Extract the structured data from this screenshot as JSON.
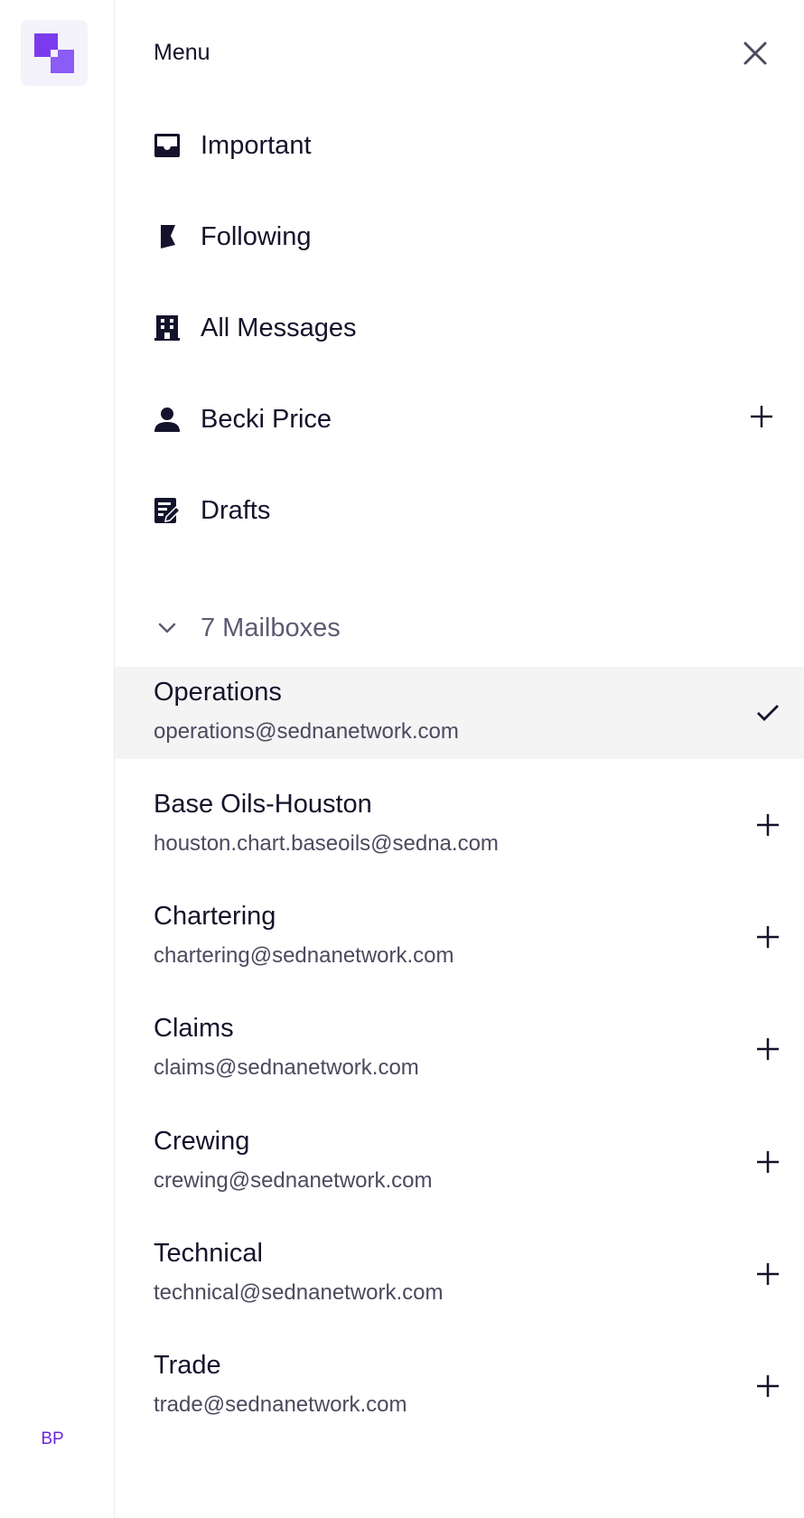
{
  "header": {
    "title": "Menu",
    "close_icon": "close-icon"
  },
  "rail": {
    "logo_icon": "app-logo-icon",
    "avatar_initials": "BP",
    "avatar_color": "#6d28d9",
    "logo_color": "#8b5cf6"
  },
  "nav": [
    {
      "label": "Important",
      "icon": "inbox-icon",
      "has_add": false
    },
    {
      "label": "Following",
      "icon": "bookmark-icon",
      "has_add": false
    },
    {
      "label": "All Messages",
      "icon": "building-icon",
      "has_add": false
    },
    {
      "label": "Becki Price",
      "icon": "person-icon",
      "has_add": true
    },
    {
      "label": "Drafts",
      "icon": "edit-note-icon",
      "has_add": false
    }
  ],
  "mailboxes": {
    "toggle_label": "7 Mailboxes",
    "items": [
      {
        "name": "Operations",
        "email": "operations@sednanetwork.com",
        "selected": true
      },
      {
        "name": "Base Oils-Houston",
        "email": "houston.chart.baseoils@sedna.com",
        "selected": false
      },
      {
        "name": "Chartering",
        "email": "chartering@sednanetwork.com",
        "selected": false
      },
      {
        "name": "Claims",
        "email": "claims@sednanetwork.com",
        "selected": false
      },
      {
        "name": "Crewing",
        "email": "crewing@sednanetwork.com",
        "selected": false
      },
      {
        "name": "Technical",
        "email": "technical@sednanetwork.com",
        "selected": false
      },
      {
        "name": "Trade",
        "email": "trade@sednanetwork.com",
        "selected": false
      }
    ]
  }
}
